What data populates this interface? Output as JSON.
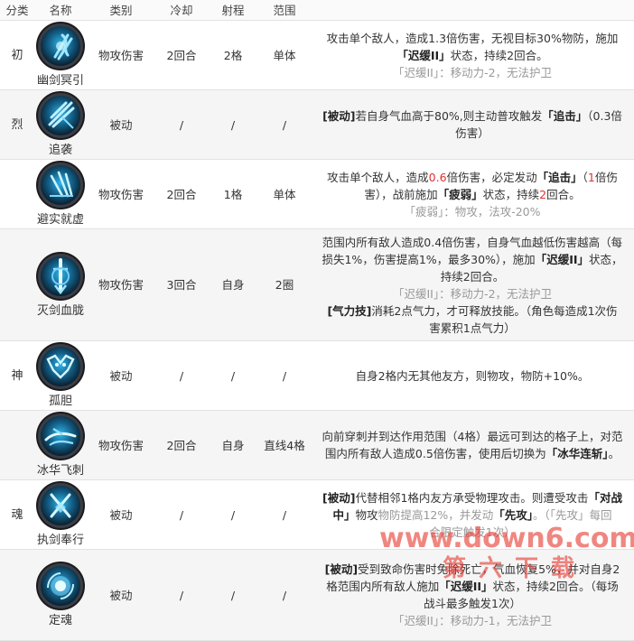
{
  "headers": {
    "category": "分类",
    "name": "名称",
    "type": "类别",
    "cooldown": "冷却",
    "range": "射程",
    "scope": "范围"
  },
  "rows": [
    {
      "category": "初",
      "name": "幽剑冥引",
      "type": "物攻伤害",
      "cooldown": "2回合",
      "range": "2格",
      "scope": "单体",
      "icon": "dark-sword-icon",
      "desc": [
        [
          {
            "t": "攻击单个敌人，造成1.3倍伤害，无视目标30%物防，施加"
          }
        ],
        [
          {
            "t": "「迟缓II」",
            "b": true
          },
          {
            "t": "状态，持续2回合。"
          }
        ],
        [
          {
            "t": "「迟缓II」：移动力-2，无法护卫",
            "g": true
          }
        ]
      ]
    },
    {
      "category": "烈",
      "name": "追袭",
      "type": "被动",
      "cooldown": "/",
      "range": "/",
      "scope": "/",
      "icon": "pursuit-icon",
      "desc": [
        [
          {
            "t": "[被动]",
            "b": true
          },
          {
            "t": "若自身气血高于80%,则主动普攻触发"
          },
          {
            "t": "「追击」",
            "b": true
          },
          {
            "t": "（0.3倍"
          }
        ],
        [
          {
            "t": "伤害）"
          }
        ]
      ]
    },
    {
      "category": "",
      "name": "避实就虚",
      "type": "物攻伤害",
      "cooldown": "2回合",
      "range": "1格",
      "scope": "单体",
      "icon": "evade-strike-icon",
      "desc": [
        [
          {
            "t": "攻击单个敌人，造成"
          },
          {
            "t": "0.6",
            "r": true
          },
          {
            "t": "倍伤害，必定发动"
          },
          {
            "t": "「追击」",
            "b": true
          },
          {
            "t": "（"
          },
          {
            "t": "1",
            "r": true
          },
          {
            "t": "倍伤"
          }
        ],
        [
          {
            "t": "害），战前施加"
          },
          {
            "t": "「疲弱」",
            "b": true
          },
          {
            "t": "状态，持续"
          },
          {
            "t": "2",
            "r": true
          },
          {
            "t": "回合。"
          }
        ],
        [
          {
            "t": "「疲弱」：物攻，法攻-20%",
            "g": true
          }
        ]
      ]
    },
    {
      "category": "",
      "name": "灭剑血胧",
      "type": "物攻伤害",
      "cooldown": "3回合",
      "range": "自身",
      "scope": "2圈",
      "icon": "blood-sword-icon",
      "desc": [
        [
          {
            "t": "范围内所有敌人造成0.4倍伤害，自身气血越低伤害越高（每"
          }
        ],
        [
          {
            "t": "损失1%，伤害提高1%，最多30%），施加"
          },
          {
            "t": "「迟缓II」",
            "b": true
          },
          {
            "t": "状态，"
          }
        ],
        [
          {
            "t": "持续2回合。"
          }
        ],
        [
          {
            "t": "「迟缓II」：移动力-2，无法护卫",
            "g": true
          }
        ],
        [
          {
            "t": "[气力技]",
            "b": true
          },
          {
            "t": "消耗2点气力，才可释放技能。（角色每造成1次伤"
          }
        ],
        [
          {
            "t": "害累积1点气力）"
          }
        ]
      ]
    },
    {
      "category": "神",
      "name": "孤胆",
      "type": "被动",
      "cooldown": "/",
      "range": "/",
      "scope": "/",
      "icon": "lone-courage-icon",
      "desc": [
        [
          {
            "t": "自身2格内无其他友方，则物攻，物防+10%。"
          }
        ]
      ]
    },
    {
      "category": "",
      "name": "冰华飞刺",
      "type": "物攻伤害",
      "cooldown": "2回合",
      "range": "自身",
      "scope": "直线4格",
      "icon": "ice-thrust-icon",
      "desc": [
        [
          {
            "t": "向前穿刺并到达作用范围（4格）最远可到达的格子上，对范"
          }
        ],
        [
          {
            "t": "围内所有敌人造成0.5倍伤害，使用后切换为"
          },
          {
            "t": "「冰华连斩」",
            "b": true
          },
          {
            "t": "。"
          }
        ]
      ]
    },
    {
      "category": "魂",
      "name": "执剑奉行",
      "type": "被动",
      "cooldown": "/",
      "range": "/",
      "scope": "/",
      "icon": "sword-guard-icon",
      "desc": [
        [
          {
            "t": "[被动]",
            "b": true
          },
          {
            "t": "代替相邻1格内友方承受物理攻击。则遭受攻击"
          },
          {
            "t": "「对战",
            "b": true
          }
        ],
        [
          {
            "t": "中」",
            "b": true
          },
          {
            "t": "物攻"
          },
          {
            "t": "物防提高12%，并发动",
            "g": true
          },
          {
            "t": "「先攻」",
            "b": true
          },
          {
            "t": "。（「先攻」每回",
            "g": true
          }
        ],
        [
          {
            "t": "合限定触发1次）",
            "g": true
          }
        ]
      ]
    },
    {
      "category": "",
      "name": "定魂",
      "type": "被动",
      "cooldown": "/",
      "range": "/",
      "scope": "/",
      "icon": "soul-orb-icon",
      "desc": [
        [
          {
            "t": "[被动]",
            "b": true
          },
          {
            "t": "受到致命伤害时免除死亡，气血恢复5%，并对自身2"
          }
        ],
        [
          {
            "t": "格范围内所有敌人施加"
          },
          {
            "t": "「迟缓II」",
            "b": true
          },
          {
            "t": "状态，持续2回合。（每场"
          }
        ],
        [
          {
            "t": "战斗最多触发1次）"
          }
        ],
        [
          {
            "t": "「迟缓II」：移动力-1，无法护卫",
            "g": true
          }
        ]
      ]
    }
  ],
  "watermark": {
    "line1": "www.down6.com",
    "line2": "第六下载"
  }
}
